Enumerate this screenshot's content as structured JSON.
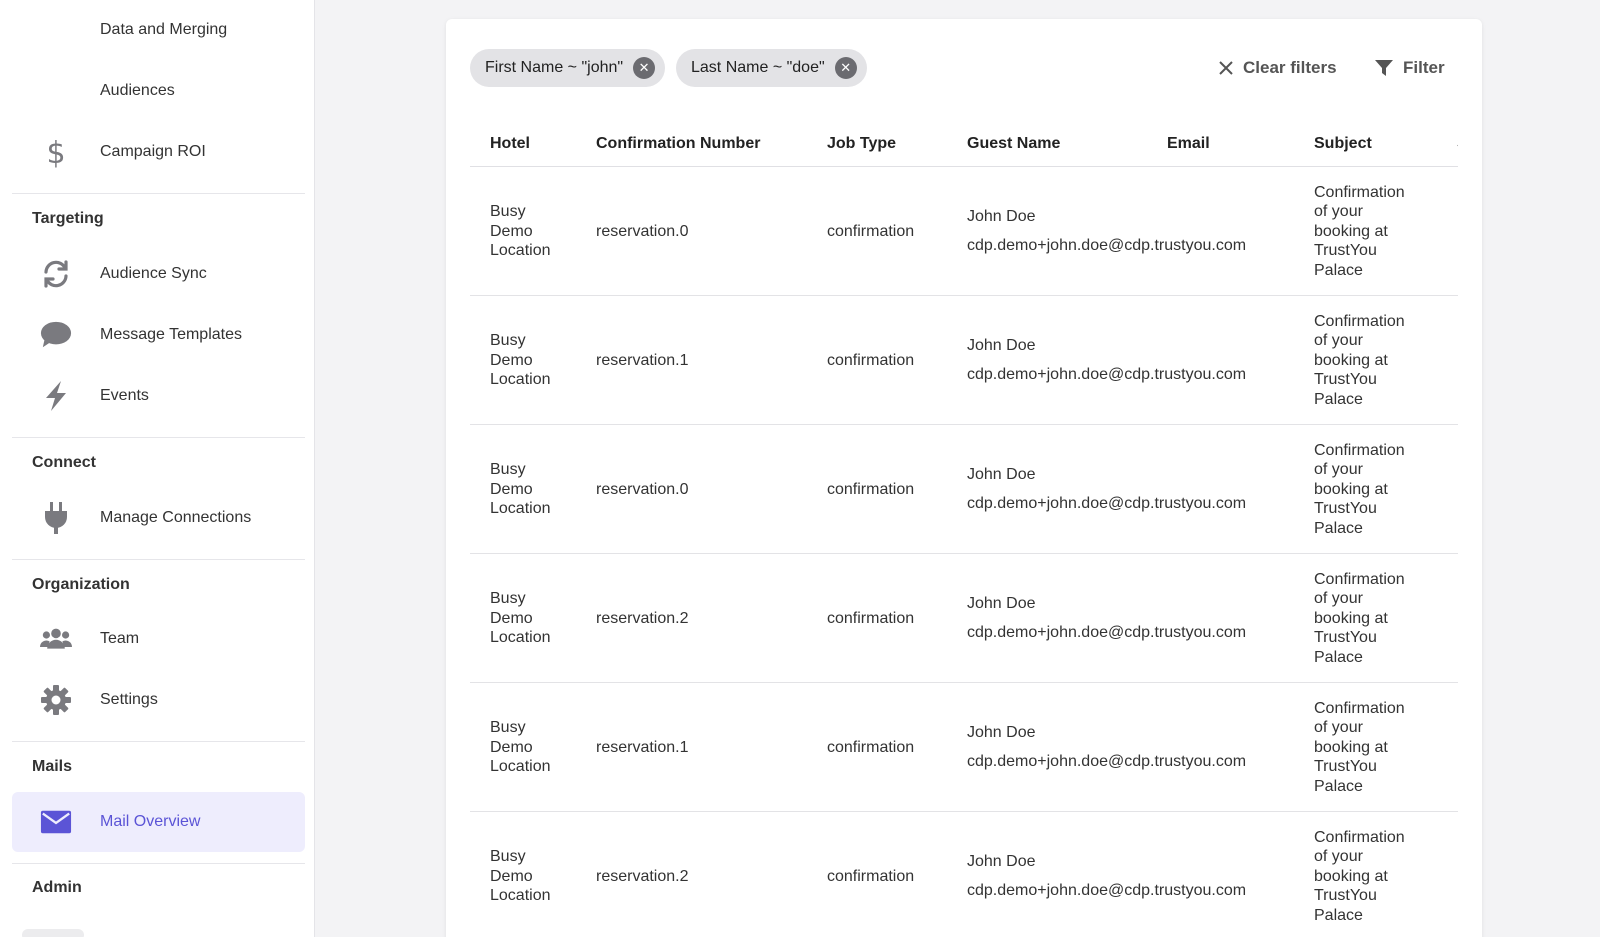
{
  "sidebar": {
    "top_items": [
      {
        "label": "Data and Merging",
        "icon": ""
      },
      {
        "label": "Audiences",
        "icon": ""
      },
      {
        "label": "Campaign ROI",
        "icon": "dollar-icon"
      }
    ],
    "sections": [
      {
        "title": "Targeting",
        "items": [
          {
            "label": "Audience Sync",
            "icon": "sync-icon"
          },
          {
            "label": "Message Templates",
            "icon": "chat-bubble-icon"
          },
          {
            "label": "Events",
            "icon": "bolt-icon"
          }
        ]
      },
      {
        "title": "Connect",
        "items": [
          {
            "label": "Manage Connections",
            "icon": "plug-icon"
          }
        ]
      },
      {
        "title": "Organization",
        "items": [
          {
            "label": "Team",
            "icon": "team-icon"
          },
          {
            "label": "Settings",
            "icon": "gear-icon"
          }
        ]
      },
      {
        "title": "Mails",
        "items": [
          {
            "label": "Mail Overview",
            "icon": "mail-icon",
            "active": true
          }
        ]
      },
      {
        "title": "Admin",
        "items": []
      }
    ]
  },
  "filters": {
    "chips": [
      {
        "label": "First Name ~ \"john\""
      },
      {
        "label": "Last Name ~ \"doe\""
      }
    ],
    "clear_label": "Clear filters",
    "filter_label": "Filter"
  },
  "table": {
    "columns": [
      "Hotel",
      "Confirmation Number",
      "Job Type",
      "Guest Name",
      "Email",
      "Subject",
      "S"
    ],
    "rows": [
      {
        "hotel": [
          "Busy",
          "Demo",
          "Location"
        ],
        "confirmation": "reservation.0",
        "job_type": "confirmation",
        "guest_name": "John Doe",
        "email": "cdp.demo+john.doe@cdp.trustyou.com",
        "subject": [
          "Confirmation",
          "of your",
          "booking at",
          "TrustYou",
          "Palace"
        ]
      },
      {
        "hotel": [
          "Busy",
          "Demo",
          "Location"
        ],
        "confirmation": "reservation.1",
        "job_type": "confirmation",
        "guest_name": "John Doe",
        "email": "cdp.demo+john.doe@cdp.trustyou.com",
        "subject": [
          "Confirmation",
          "of your",
          "booking at",
          "TrustYou",
          "Palace"
        ]
      },
      {
        "hotel": [
          "Busy",
          "Demo",
          "Location"
        ],
        "confirmation": "reservation.0",
        "job_type": "confirmation",
        "guest_name": "John Doe",
        "email": "cdp.demo+john.doe@cdp.trustyou.com",
        "subject": [
          "Confirmation",
          "of your",
          "booking at",
          "TrustYou",
          "Palace"
        ]
      },
      {
        "hotel": [
          "Busy",
          "Demo",
          "Location"
        ],
        "confirmation": "reservation.2",
        "job_type": "confirmation",
        "guest_name": "John Doe",
        "email": "cdp.demo+john.doe@cdp.trustyou.com",
        "subject": [
          "Confirmation",
          "of your",
          "booking at",
          "TrustYou",
          "Palace"
        ]
      },
      {
        "hotel": [
          "Busy",
          "Demo",
          "Location"
        ],
        "confirmation": "reservation.1",
        "job_type": "confirmation",
        "guest_name": "John Doe",
        "email": "cdp.demo+john.doe@cdp.trustyou.com",
        "subject": [
          "Confirmation",
          "of your",
          "booking at",
          "TrustYou",
          "Palace"
        ]
      },
      {
        "hotel": [
          "Busy",
          "Demo",
          "Location"
        ],
        "confirmation": "reservation.2",
        "job_type": "confirmation",
        "guest_name": "John Doe",
        "email": "cdp.demo+john.doe@cdp.trustyou.com",
        "subject": [
          "Confirmation",
          "of your",
          "booking at",
          "TrustYou",
          "Palace"
        ]
      }
    ]
  },
  "colors": {
    "accent": "#5b54d6",
    "active_bg": "#eeedfd",
    "icon_gray": "#7a7a7f"
  }
}
